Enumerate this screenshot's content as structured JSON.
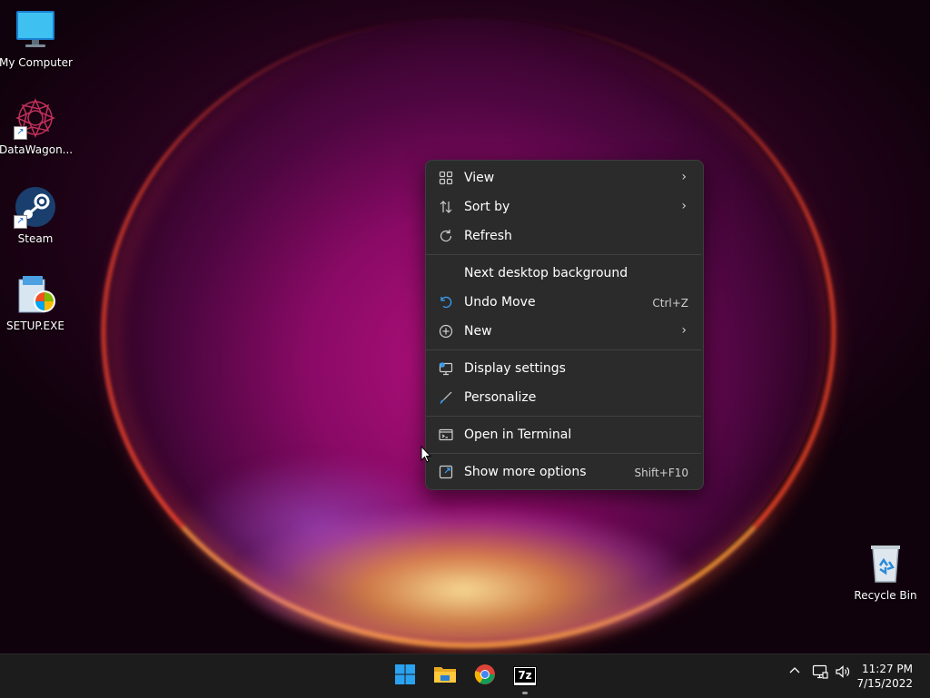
{
  "desktop": {
    "icons": [
      {
        "label": "My Computer",
        "icon": "monitor-icon"
      },
      {
        "label": "DataWagon...",
        "icon": "datawagon-icon"
      },
      {
        "label": "Steam",
        "icon": "steam-icon"
      },
      {
        "label": "SETUP.EXE",
        "icon": "setup-installer-icon"
      }
    ],
    "recycle_bin": {
      "label": "Recycle Bin",
      "icon": "recycle-bin-icon"
    }
  },
  "context_menu": {
    "items": [
      {
        "label": "View",
        "icon": "grid-icon",
        "submenu": true
      },
      {
        "label": "Sort by",
        "icon": "sort-icon",
        "submenu": true
      },
      {
        "label": "Refresh",
        "icon": "refresh-icon"
      },
      {
        "label": "Next desktop background"
      },
      {
        "label": "Undo Move",
        "icon": "undo-icon",
        "shortcut": "Ctrl+Z"
      },
      {
        "label": "New",
        "icon": "plus-circle-icon",
        "submenu": true
      },
      {
        "label": "Display settings",
        "icon": "display-settings-icon"
      },
      {
        "label": "Personalize",
        "icon": "brush-icon"
      },
      {
        "label": "Open in Terminal",
        "icon": "terminal-icon"
      },
      {
        "label": "Show more options",
        "icon": "more-options-icon",
        "shortcut": "Shift+F10"
      }
    ],
    "submenu_arrow": "›"
  },
  "taskbar": {
    "pinned": [
      "start-icon",
      "file-explorer-icon",
      "chrome-icon",
      "7zip-icon"
    ],
    "sevenzip_label": "7z",
    "tray": {
      "chevron": "^"
    },
    "clock": {
      "time": "11:27 PM",
      "date": "7/15/2022"
    }
  },
  "colors": {
    "menu_bg": "#2b2b2b",
    "taskbar_bg": "#1c1c1c",
    "accent_blue": "#3b9cf0"
  }
}
